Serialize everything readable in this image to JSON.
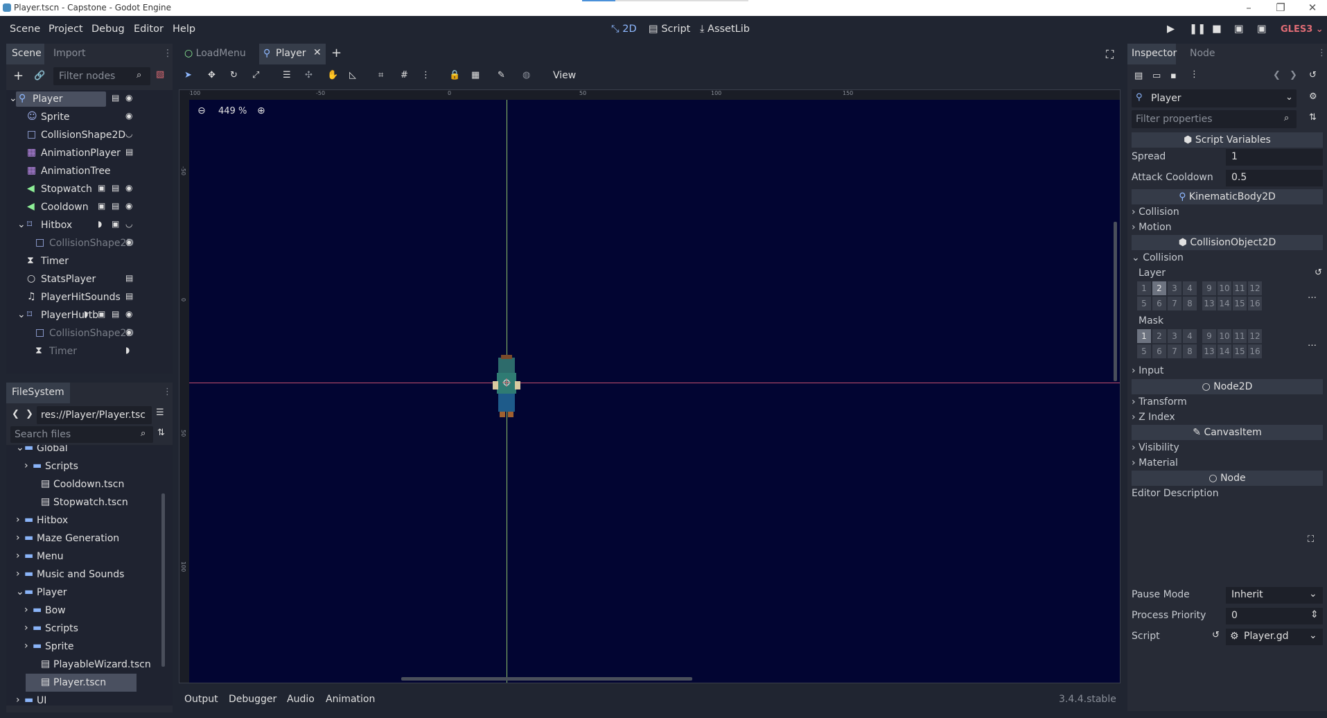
{
  "window": {
    "title": "Player.tscn - Capstone - Godot Engine",
    "progress": 0.2
  },
  "menu": {
    "items": [
      "Scene",
      "Project",
      "Debug",
      "Editor",
      "Help"
    ]
  },
  "workspaces": {
    "twod": "2D",
    "script": "Script",
    "assetlib": "AssetLib"
  },
  "renderer": "GLES3 ⌄",
  "scene_dock": {
    "tabs": [
      "Scene",
      "Import"
    ],
    "filter_placeholder": "Filter nodes",
    "nodes": [
      {
        "label": "Player",
        "icon": "kinematic-body-icon",
        "color": "#8eb8ff"
      },
      {
        "label": "Sprite",
        "icon": "sprite-icon",
        "color": "#a5b7f3"
      },
      {
        "label": "CollisionShape2D",
        "icon": "collision-shape-icon",
        "color": "#a5b7f3"
      },
      {
        "label": "AnimationPlayer",
        "icon": "animation-player-icon",
        "color": "#c38ef1"
      },
      {
        "label": "AnimationTree",
        "icon": "animation-tree-icon",
        "color": "#c38ef1"
      },
      {
        "label": "Stopwatch",
        "icon": "timer-label-icon",
        "color": "#8eef97"
      },
      {
        "label": "Cooldown",
        "icon": "timer-label-icon",
        "color": "#8eef97"
      },
      {
        "label": "Hitbox",
        "icon": "area-icon",
        "color": "#a5b7f3"
      },
      {
        "label": "CollisionShape2D",
        "icon": "collision-shape-icon",
        "color": "#a5b7f3"
      },
      {
        "label": "Timer",
        "icon": "timer-icon",
        "color": "#e0e0e0"
      },
      {
        "label": "StatsPlayer",
        "icon": "node-icon",
        "color": "#e0e0e0"
      },
      {
        "label": "PlayerHitSounds",
        "icon": "audio-icon",
        "color": "#e0e0e0"
      },
      {
        "label": "PlayerHurtb",
        "icon": "area-icon",
        "color": "#a5b7f3"
      },
      {
        "label": "CollisionShape2D",
        "icon": "collision-shape-icon",
        "color": "#a5b7f3"
      },
      {
        "label": "Timer",
        "icon": "timer-icon",
        "color": "#e0e0e0"
      }
    ]
  },
  "filesystem": {
    "title": "FileSystem",
    "path": "res://Player/Player.tsc",
    "search_placeholder": "Search files",
    "items": [
      {
        "label": "Global",
        "type": "folder"
      },
      {
        "label": "Scripts",
        "type": "folder"
      },
      {
        "label": "Cooldown.tscn",
        "type": "scene"
      },
      {
        "label": "Stopwatch.tscn",
        "type": "scene"
      },
      {
        "label": "Hitbox",
        "type": "folder"
      },
      {
        "label": "Maze Generation",
        "type": "folder"
      },
      {
        "label": "Menu",
        "type": "folder"
      },
      {
        "label": "Music and Sounds",
        "type": "folder"
      },
      {
        "label": "Player",
        "type": "folder"
      },
      {
        "label": "Bow",
        "type": "folder"
      },
      {
        "label": "Scripts",
        "type": "folder"
      },
      {
        "label": "Sprite",
        "type": "folder"
      },
      {
        "label": "PlayableWizard.tscn",
        "type": "scene"
      },
      {
        "label": "Player.tscn",
        "type": "scene"
      },
      {
        "label": "UI",
        "type": "folder"
      }
    ]
  },
  "editor": {
    "tabs": [
      "LoadMenu",
      "Player"
    ],
    "view_menu": "View",
    "zoom": "449 %",
    "ruler_h": [
      "-100",
      "-50",
      "0",
      "50",
      "100",
      "150"
    ],
    "ruler_v": [
      "-50",
      "0",
      "50",
      "100"
    ],
    "bottom_tabs": [
      "Output",
      "Debugger",
      "Audio",
      "Animation"
    ],
    "version": "3.4.4.stable"
  },
  "inspector": {
    "tabs": [
      "Inspector",
      "Node"
    ],
    "object": "Player",
    "filter_placeholder": "Filter properties",
    "script_variables": "Script Variables",
    "spread_label": "Spread",
    "spread_value": "1",
    "attack_cooldown_label": "Attack Cooldown",
    "attack_cooldown_value": "0.5",
    "kinematic": "KinematicBody2D",
    "collision": "Collision",
    "motion": "Motion",
    "collision_object": "CollisionObject2D",
    "collision2": "Collision",
    "layer_label": "Layer",
    "mask_label": "Mask",
    "bits_row1": [
      "1",
      "2",
      "3",
      "4",
      "9",
      "10",
      "11",
      "12"
    ],
    "bits_row2": [
      "5",
      "6",
      "7",
      "8",
      "13",
      "14",
      "15",
      "16"
    ],
    "input": "Input",
    "node2d": "Node2D",
    "transform": "Transform",
    "zindex": "Z Index",
    "canvasitem": "CanvasItem",
    "visibility": "Visibility",
    "material": "Material",
    "node": "Node",
    "editor_description": "Editor Description",
    "pause_mode_label": "Pause Mode",
    "pause_mode_value": "Inherit",
    "process_priority_label": "Process Priority",
    "process_priority_value": "0",
    "script_label": "Script",
    "script_value": "Player.gd"
  }
}
